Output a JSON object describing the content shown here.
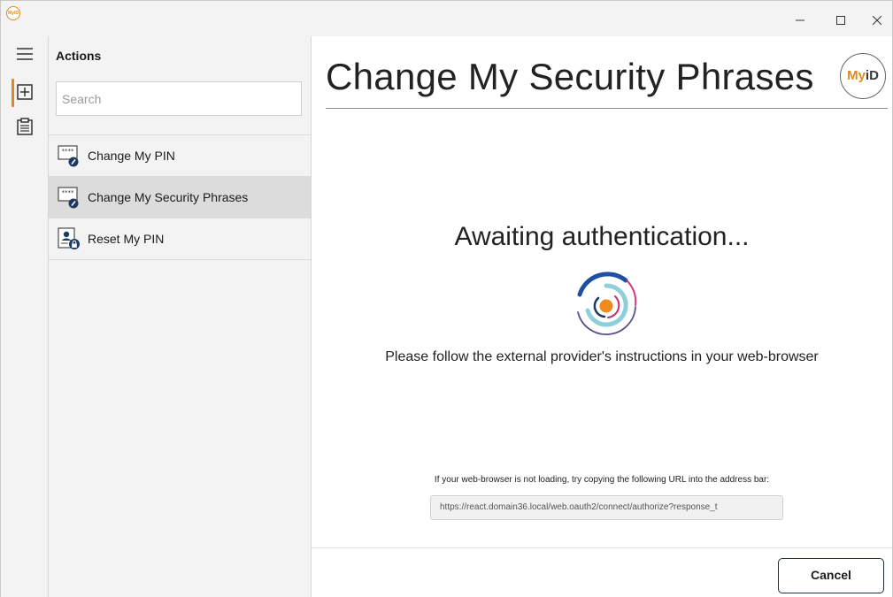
{
  "window": {
    "app_icon_text": "MyID",
    "controls": {
      "minimize_icon": "minimize-icon",
      "maximize_icon": "maximize-icon",
      "close_icon": "close-icon"
    }
  },
  "rail": {
    "items": [
      {
        "name": "menu",
        "icon": "hamburger-menu-icon"
      },
      {
        "name": "actions",
        "icon": "plus-box-icon",
        "active": true
      },
      {
        "name": "reports",
        "icon": "clipboard-icon"
      }
    ],
    "accent_color": "#e08a1e"
  },
  "sidebar": {
    "title": "Actions",
    "search": {
      "placeholder": "Search",
      "value": ""
    },
    "items": [
      {
        "label": "Change My PIN",
        "icon": "pin-change-icon",
        "selected": false
      },
      {
        "label": "Change My Security Phrases",
        "icon": "pin-change-icon",
        "selected": true
      },
      {
        "label": "Reset My PIN",
        "icon": "id-card-lock-icon",
        "selected": false
      }
    ]
  },
  "main": {
    "title": "Change My Security Phrases",
    "logo": {
      "my": "My",
      "id": "iD"
    },
    "status": "Awaiting authentication...",
    "instruction": "Please follow the external provider's instructions in your web-browser",
    "url_hint": "If your web-browser is not loading, try copying the following URL into the address bar:",
    "url_value": "https://react.domain36.local/web.oauth2/connect/authorize?response_t",
    "cancel_label": "Cancel"
  },
  "colors": {
    "brand_orange": "#e08a1e",
    "brand_blue": "#1e4fa3",
    "teal": "#7ec8d4",
    "magenta": "#c0306a",
    "purple": "#5a4e8c",
    "button_border": "#1c2b44"
  }
}
